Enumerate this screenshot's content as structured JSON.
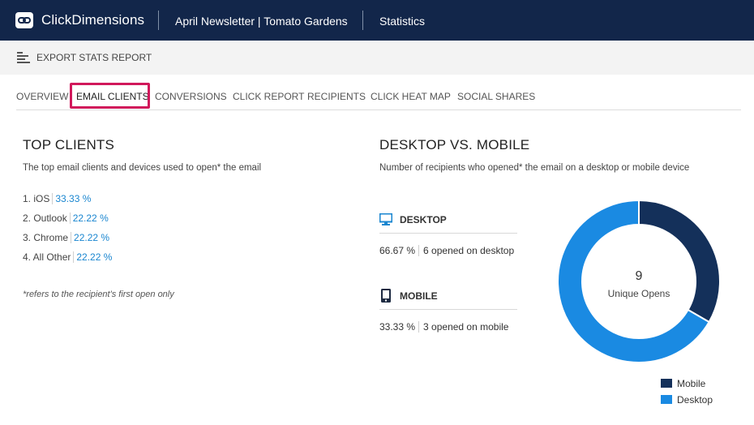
{
  "header": {
    "brand": "ClickDimensions",
    "email_name": "April Newsletter | Tomato Gardens",
    "section": "Statistics"
  },
  "toolbar": {
    "export_label": "EXPORT STATS REPORT"
  },
  "tabs": [
    {
      "label": "OVERVIEW",
      "active": false
    },
    {
      "label": "EMAIL CLIENTS",
      "active": true
    },
    {
      "label": "CONVERSIONS",
      "active": false
    },
    {
      "label": "CLICK REPORT",
      "active": false
    },
    {
      "label": "RECIPIENTS",
      "active": false
    },
    {
      "label": "CLICK HEAT MAP",
      "active": false
    },
    {
      "label": "SOCIAL SHARES",
      "active": false
    }
  ],
  "top_clients": {
    "title": "TOP CLIENTS",
    "description": "The top email clients and devices used to open* the email",
    "items": [
      {
        "name": "1. iOS",
        "percent": "33.33 %"
      },
      {
        "name": "2. Outlook",
        "percent": "22.22 %"
      },
      {
        "name": "3. Chrome",
        "percent": "22.22 %"
      },
      {
        "name": "4. All Other",
        "percent": "22.22 %"
      }
    ],
    "note": "*refers to the recipient's first open only"
  },
  "desktop_mobile": {
    "title": "DESKTOP VS. MOBILE",
    "description": "Number of recipients who opened* the email on a desktop or mobile device",
    "desktop": {
      "label": "DESKTOP",
      "percent": "66.67 %",
      "text": "6 opened on desktop"
    },
    "mobile": {
      "label": "MOBILE",
      "percent": "33.33 %",
      "text": "3 opened on mobile"
    }
  },
  "chart_data": {
    "type": "pie",
    "categories": [
      "Mobile",
      "Desktop"
    ],
    "values": [
      3,
      6
    ],
    "colors": [
      "#14305a",
      "#1a8ae2"
    ],
    "center_value": "9",
    "center_label": "Unique Opens",
    "legend": "bottom-right"
  },
  "colors": {
    "header_bg": "#12264a",
    "accent_blue": "#1a86d0",
    "active_tab_outline": "#d1185b"
  },
  "icons": {
    "logo": "link-icon",
    "export": "bar-chart-icon",
    "desktop": "monitor-icon",
    "mobile": "phone-icon"
  }
}
